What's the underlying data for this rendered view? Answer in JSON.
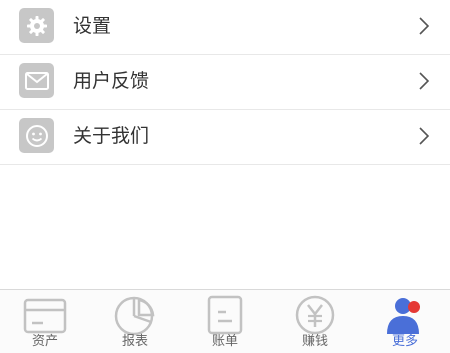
{
  "menu": {
    "items": [
      {
        "label": "设置",
        "icon": "gear-icon"
      },
      {
        "label": "用户反馈",
        "icon": "mail-icon"
      },
      {
        "label": "关于我们",
        "icon": "smiley-icon"
      }
    ]
  },
  "tabbar": {
    "active_color": "#4a6fd8",
    "badge_color": "#e53935",
    "tabs": [
      {
        "label": "资产",
        "icon": "card-icon"
      },
      {
        "label": "报表",
        "icon": "pie-chart-icon"
      },
      {
        "label": "账单",
        "icon": "bill-icon"
      },
      {
        "label": "赚钱",
        "icon": "yen-icon"
      },
      {
        "label": "更多",
        "icon": "user-more-icon",
        "active": true
      }
    ]
  }
}
